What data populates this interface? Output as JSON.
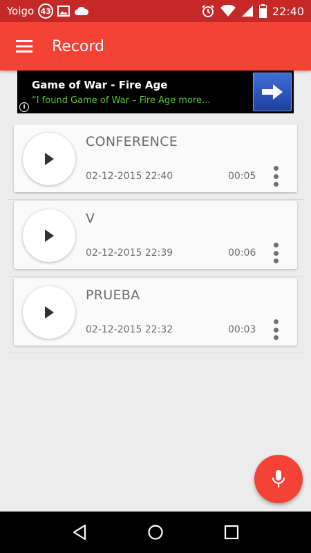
{
  "status_bar": {
    "carrier": "Yoigo",
    "badge_count": "43",
    "time": "22:40",
    "icons": [
      "image-icon",
      "cloud-icon",
      "alarm-icon",
      "wifi-icon",
      "signal-icon",
      "battery-icon"
    ]
  },
  "app_bar": {
    "title": "Record",
    "menu_icon": "hamburger-menu-icon"
  },
  "ad": {
    "title": "Game of War - Fire Age",
    "subtitle": "“I found Game of War – Fire Age more...",
    "info_glyph": "i"
  },
  "recordings": [
    {
      "name": "CONFERENCE",
      "date": "02-12-2015 22:40",
      "duration": "00:05"
    },
    {
      "name": "V",
      "date": "02-12-2015 22:39",
      "duration": "00:06"
    },
    {
      "name": "PRUEBA",
      "date": "02-12-2015 22:32",
      "duration": "00:03"
    }
  ],
  "fab": {
    "icon": "microphone-icon"
  },
  "nav": {
    "icons": [
      "back-icon",
      "home-icon",
      "recents-icon"
    ]
  },
  "colors": {
    "primary": "#f44336",
    "status_bar": "#c62828",
    "ad_green": "#55c532",
    "text_gray": "#6b6b6b"
  }
}
